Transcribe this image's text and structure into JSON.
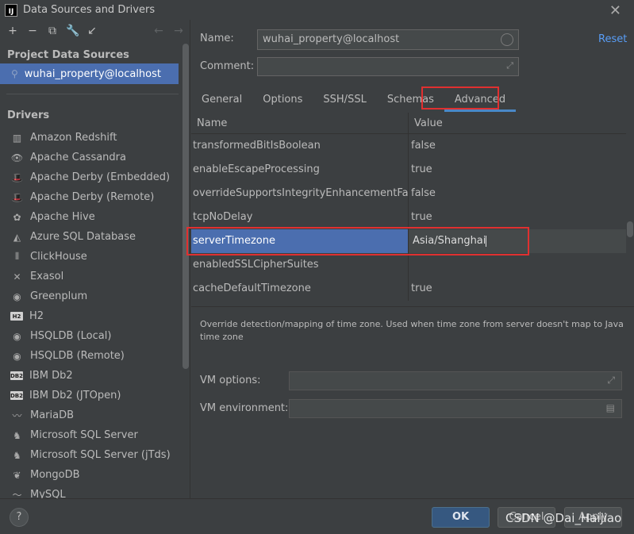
{
  "window": {
    "title": "Data Sources and Drivers"
  },
  "left_panel": {
    "project_section_title": "Project Data Sources",
    "project_item": "wuhai_property@localhost",
    "drivers_section_title": "Drivers",
    "drivers": [
      {
        "label": "Amazon Redshift",
        "icon": "amazon-redshift-icon",
        "glyph": "▥"
      },
      {
        "label": "Apache Cassandra",
        "icon": "cassandra-eye-icon",
        "glyph": "👁"
      },
      {
        "label": "Apache Derby (Embedded)",
        "icon": "derby-hat-icon",
        "glyph": "🎩"
      },
      {
        "label": "Apache Derby (Remote)",
        "icon": "derby-hat-icon",
        "glyph": "🎩"
      },
      {
        "label": "Apache Hive",
        "icon": "hive-bee-icon",
        "glyph": "✿"
      },
      {
        "label": "Azure SQL Database",
        "icon": "azure-icon",
        "glyph": "◭"
      },
      {
        "label": "ClickHouse",
        "icon": "clickhouse-bars-icon",
        "glyph": "⦀"
      },
      {
        "label": "Exasol",
        "icon": "exasol-x-icon",
        "glyph": "✕"
      },
      {
        "label": "Greenplum",
        "icon": "greenplum-circle-icon",
        "glyph": "◉"
      },
      {
        "label": "H2",
        "icon": "h2-box-icon",
        "glyph": "H2"
      },
      {
        "label": "HSQLDB (Local)",
        "icon": "hsqldb-circle-icon",
        "glyph": "◉"
      },
      {
        "label": "HSQLDB (Remote)",
        "icon": "hsqldb-circle-icon",
        "glyph": "◉"
      },
      {
        "label": "IBM Db2",
        "icon": "db2-box-icon",
        "glyph": "DB2"
      },
      {
        "label": "IBM Db2 (JTOpen)",
        "icon": "db2-box-icon",
        "glyph": "DB2"
      },
      {
        "label": "MariaDB",
        "icon": "mariadb-seal-icon",
        "glyph": "〰"
      },
      {
        "label": "Microsoft SQL Server",
        "icon": "sqlserver-icon",
        "glyph": "♞"
      },
      {
        "label": "Microsoft SQL Server (jTds)",
        "icon": "sqlserver-icon",
        "glyph": "♞"
      },
      {
        "label": "MongoDB",
        "icon": "mongodb-leaf-icon",
        "glyph": "❦"
      },
      {
        "label": "MySQL",
        "icon": "mysql-dolphin-icon",
        "glyph": "〜"
      }
    ]
  },
  "form": {
    "name_label": "Name:",
    "name_value": "wuhai_property@localhost",
    "comment_label": "Comment:",
    "comment_value": "",
    "reset_label": "Reset"
  },
  "tabs": [
    "General",
    "Options",
    "SSH/SSL",
    "Schemas",
    "Advanced"
  ],
  "active_tab": "Advanced",
  "table": {
    "headers": [
      "Name",
      "Value"
    ],
    "rows": [
      {
        "name": "transformedBitIsBoolean",
        "value": "false"
      },
      {
        "name": "enableEscapeProcessing",
        "value": "true"
      },
      {
        "name": "overrideSupportsIntegrityEnhancementFacility",
        "value": "false"
      },
      {
        "name": "tcpNoDelay",
        "value": "true"
      },
      {
        "name": "serverTimezone",
        "value": "Asia/Shanghai"
      },
      {
        "name": "enabledSSLCipherSuites",
        "value": ""
      },
      {
        "name": "cacheDefaultTimezone",
        "value": "true"
      }
    ],
    "selected_row": 4
  },
  "description": "Override detection/mapping of time zone. Used when time zone from server doesn't map to Java time zone",
  "vm": {
    "options_label": "VM options:",
    "options_value": "",
    "environment_label": "VM environment:",
    "environment_value": ""
  },
  "buttons": {
    "help": "?",
    "ok": "OK",
    "cancel": "Cancel",
    "apply": "Apply"
  },
  "watermark": "CSDN @Dai_Haijiao",
  "colors": {
    "background": "#3c3f41",
    "selection": "#4b6eaf",
    "highlight_border": "#e03030",
    "link": "#589df6",
    "ok_button": "#365880"
  }
}
